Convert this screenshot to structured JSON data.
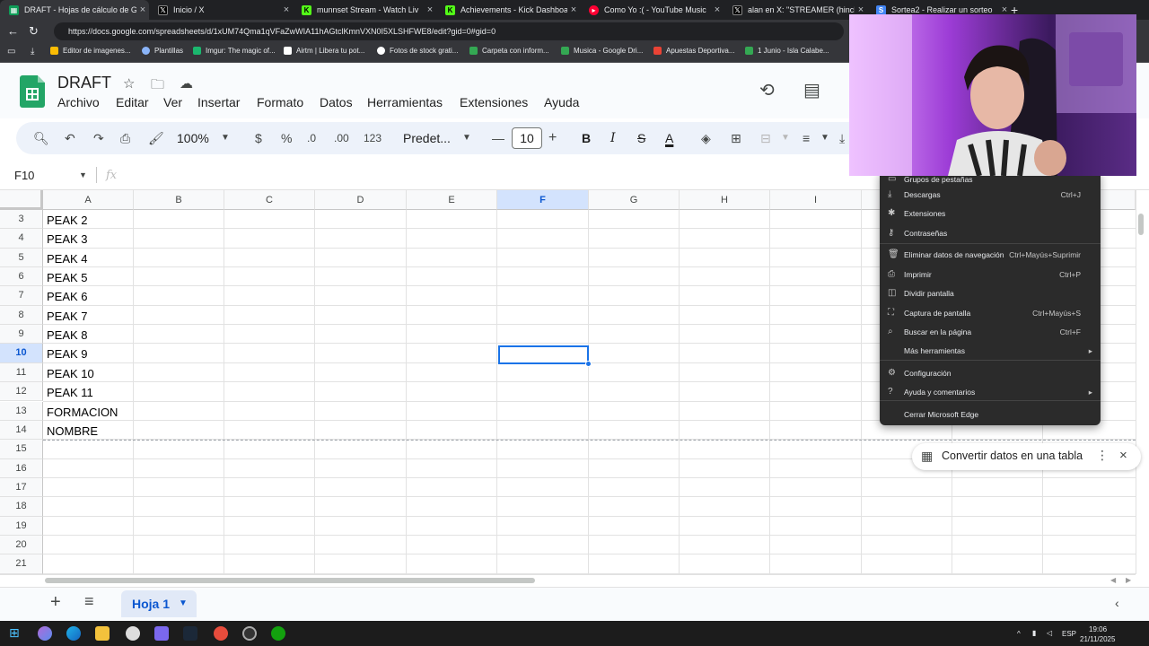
{
  "browser": {
    "tabs": [
      {
        "title": "DRAFT - Hojas de cálculo de Goo",
        "color": "#0f9d58",
        "active": true
      },
      {
        "title": "Inicio / X",
        "color": "#000000"
      },
      {
        "title": "munnset Stream - Watch Liv",
        "color": "#53fc18"
      },
      {
        "title": "Achievements - Kick Dashboard",
        "color": "#53fc18"
      },
      {
        "title": "Como Yo :( - YouTube Music",
        "color": "#ff0033"
      },
      {
        "title": "alan en X: \"STREAMER (hincha de",
        "color": "#000000"
      },
      {
        "title": "Sortea2 - Realizar un sorteo",
        "color": "#4285f4"
      }
    ],
    "url": "https://docs.google.com/spreadsheets/d/1xUM74Qma1qVFaZwWIA11hAGtclKmnVXN0I5XLSHFWE8/edit?gid=0#gid=0",
    "bookmarks": [
      {
        "label": "Editor de imagenes...",
        "color": "#fbbc04"
      },
      {
        "label": "Plantillas",
        "color": "#8ab4f8"
      },
      {
        "label": "Imgur: The magic of...",
        "color": "#1bb76e"
      },
      {
        "label": "Airtm | Libera tu pot...",
        "color": "#ffffff"
      },
      {
        "label": "Fotos de stock grati...",
        "color": "#ffffff"
      },
      {
        "label": "Carpeta con inform...",
        "color": "#34a853"
      },
      {
        "label": "Musica - Google Dri...",
        "color": "#34a853"
      },
      {
        "label": "Apuestas Deportiva...",
        "color": "#ea4335"
      },
      {
        "label": "1 Junio - Isla Calabe...",
        "color": "#34a853"
      }
    ]
  },
  "sheets": {
    "doc_title": "DRAFT",
    "menus": [
      "Archivo",
      "Editar",
      "Ver",
      "Insertar",
      "Formato",
      "Datos",
      "Herramientas",
      "Extensiones",
      "Ayuda"
    ],
    "toolbar": {
      "zoom": "100%",
      "currency": "$",
      "percent": "%",
      "dec_decrease": ".0",
      "dec_increase": ".00",
      "number_format": "123",
      "font": "Predet...",
      "font_size": "10",
      "bold": "B",
      "italic": "I",
      "strike": "S",
      "text_color": "A"
    },
    "name_box": "F10",
    "fx": "fx",
    "columns": [
      "A",
      "B",
      "C",
      "D",
      "E",
      "F",
      "G",
      "H",
      "I"
    ],
    "rows": [
      "3",
      "4",
      "5",
      "6",
      "7",
      "8",
      "9",
      "10",
      "11",
      "12",
      "13",
      "14",
      "15",
      "16",
      "17",
      "18",
      "19",
      "20",
      "21"
    ],
    "cells_col_a": [
      "PEAK 2",
      "PEAK 3",
      "PEAK 4",
      "PEAK 5",
      "PEAK 6",
      "PEAK 7",
      "PEAK 8",
      "PEAK 9",
      "PEAK 10",
      "PEAK 11",
      "FORMACION",
      "NOMBRE"
    ],
    "sheet_tab": "Hoja 1",
    "convert_chip": "Convertir datos en una tabla"
  },
  "context_menu": {
    "items": [
      {
        "icon": "▭",
        "label": "Grupos de pestañas",
        "shortcut": ""
      },
      {
        "icon": "⤓",
        "label": "Descargas",
        "shortcut": "Ctrl+J"
      },
      {
        "icon": "✱",
        "label": "Extensiones",
        "shortcut": ""
      },
      {
        "icon": "⚷",
        "label": "Contraseñas",
        "shortcut": ""
      },
      {
        "icon": "🗑",
        "label": "Eliminar datos de navegación",
        "shortcut": "Ctrl+Mayús+Suprimir"
      },
      {
        "icon": "⎙",
        "label": "Imprimir",
        "shortcut": "Ctrl+P"
      },
      {
        "icon": "◫",
        "label": "Dividir pantalla",
        "shortcut": ""
      },
      {
        "icon": "⛶",
        "label": "Captura de pantalla",
        "shortcut": "Ctrl+Mayús+S"
      },
      {
        "icon": "⌕",
        "label": "Buscar en la página",
        "shortcut": "Ctrl+F"
      },
      {
        "icon": "",
        "label": "Más herramientas",
        "shortcut": ""
      },
      {
        "icon": "⚙",
        "label": "Configuración",
        "shortcut": ""
      },
      {
        "icon": "?",
        "label": "Ayuda y comentarios",
        "shortcut": ""
      },
      {
        "icon": "",
        "label": "Cerrar Microsoft Edge",
        "shortcut": ""
      }
    ]
  },
  "taskbar": {
    "lang": "ESP",
    "time": "19:06",
    "date": "21/11/2025"
  },
  "colors": {
    "accent": "#0b57d0",
    "selection": "#1a73e8",
    "sheets_green": "#23a566"
  }
}
